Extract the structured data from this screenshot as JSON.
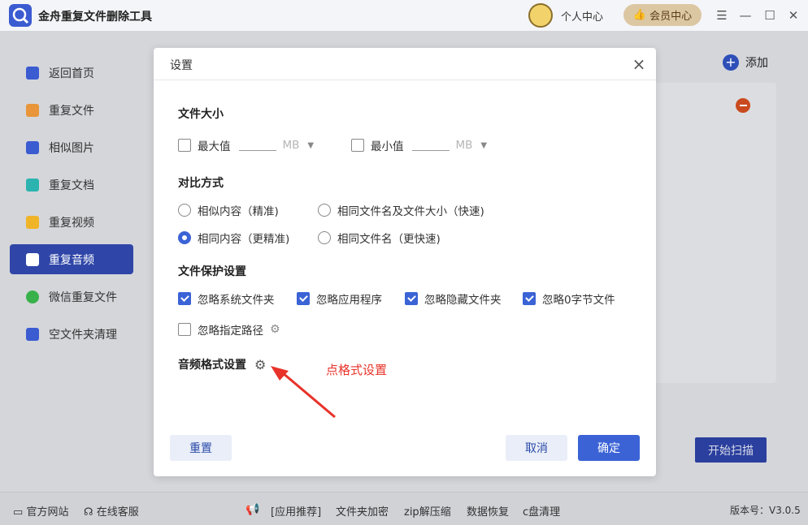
{
  "app": {
    "title": "金舟重复文件删除工具",
    "user_center": "个人中心",
    "vip": "会员中心"
  },
  "window": {
    "menu": "☰",
    "minimize": "—",
    "maximize": "☐",
    "close": "✕"
  },
  "sidebar": {
    "items": [
      {
        "label": "返回首页",
        "icon": "home-icon",
        "color": "#3b5bd1"
      },
      {
        "label": "重复文件",
        "icon": "folder-icon",
        "color": "#e9963a"
      },
      {
        "label": "相似图片",
        "icon": "image-icon",
        "color": "#3b5bd1"
      },
      {
        "label": "重复文档",
        "icon": "document-icon",
        "color": "#2bb3b0"
      },
      {
        "label": "重复视频",
        "icon": "video-icon",
        "color": "#f0b429"
      },
      {
        "label": "重复音频",
        "icon": "audio-icon",
        "color": "#ffffff"
      },
      {
        "label": "微信重复文件",
        "icon": "wechat-icon",
        "color": "#38b14a"
      },
      {
        "label": "空文件夹清理",
        "icon": "empty-folder-icon",
        "color": "#3b5bd1"
      }
    ],
    "active_index": 5
  },
  "main": {
    "add_label": "添加",
    "start_scan": "开始扫描"
  },
  "dialog": {
    "title": "设置",
    "file_size": {
      "heading": "文件大小",
      "max": {
        "label": "最大值",
        "checked": false,
        "unit": "MB"
      },
      "min": {
        "label": "最小值",
        "checked": false,
        "unit": "MB"
      }
    },
    "compare": {
      "heading": "对比方式",
      "options": [
        {
          "label": "相似内容（精准)",
          "selected": false
        },
        {
          "label": "相同文件名及文件大小（快速)",
          "selected": false
        },
        {
          "label": "相同内容（更精准)",
          "selected": true
        },
        {
          "label": "相同文件名（更快速)",
          "selected": false
        }
      ]
    },
    "protect": {
      "heading": "文件保护设置",
      "options": [
        {
          "label": "忽略系统文件夹",
          "checked": true
        },
        {
          "label": "忽略应用程序",
          "checked": true
        },
        {
          "label": "忽略隐藏文件夹",
          "checked": true
        },
        {
          "label": "忽略0字节文件",
          "checked": true
        },
        {
          "label": "忽略指定路径",
          "checked": false
        }
      ]
    },
    "audio": {
      "heading": "音频格式设置"
    },
    "annotation": "点格式设置",
    "reset": "重置",
    "cancel": "取消",
    "ok": "确定"
  },
  "bottom": {
    "website": "官方网站",
    "service": "在线客服",
    "links": [
      "[应用推荐]",
      "文件夹加密",
      "zip解压缩",
      "数据恢复",
      "c盘清理"
    ],
    "version": "版本号：V3.0.5"
  },
  "colors": {
    "accent": "#3b63d6",
    "sidebar_active": "#2f46a8",
    "annotation": "#e8332a",
    "vip_bg": "#dcc7a3"
  }
}
